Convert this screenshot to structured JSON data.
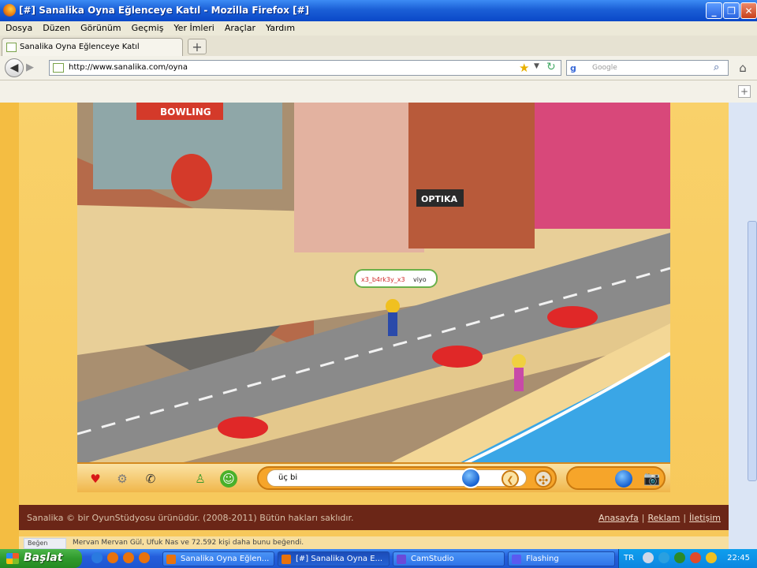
{
  "window": {
    "title": "[#] Sanalika Oyna Eğlenceye Katıl - Mozilla Firefox [#]",
    "minimize": "_",
    "maximize": "❐",
    "close": "✕"
  },
  "menu": {
    "items": [
      "Dosya",
      "Düzen",
      "Görünüm",
      "Geçmiş",
      "Yer İmleri",
      "Araçlar",
      "Yardım"
    ]
  },
  "tabs": [
    {
      "label": "Sanalika Oyna Eğlenceye Katıl"
    }
  ],
  "newtab": "+",
  "navbar": {
    "back": "◀",
    "forward": "▶",
    "url": "http://www.sanalika.com/oyna",
    "search_engine": "g",
    "search_placeholder": "Google",
    "home": "⌂"
  },
  "bookmarks": {
    "add": "+"
  },
  "game": {
    "player_name": "x3_b4rk3y_x3",
    "speech": "viyo",
    "shop_sign_1": "OPTIKA",
    "shop_sign_2": "BOWLING",
    "chat_input_value": "üç bi",
    "toolbar_icons": [
      "heart-icon",
      "gear-icon",
      "phone-icon",
      "person-icon",
      "smiley-icon",
      "speech-icon",
      "compass-icon",
      "camera-icon"
    ]
  },
  "footer": {
    "copyright": "Sanalika © bir OyunStüdyosu ürünüdür. (2008-2011) Bütün hakları saklıdır.",
    "links": [
      "Anasayfa",
      "Reklam",
      "İletişim"
    ]
  },
  "fb": {
    "like": "Beğen",
    "text": "Mervan Mervan Gül, Ufuk Nas ve 72.592 kişi daha bunu beğendi."
  },
  "taskbar": {
    "start": "Başlat",
    "tasks": [
      "Sanalika Oyna Eğlen...",
      "[#] Sanalika Oyna E...",
      "CamStudio",
      "Flashing"
    ],
    "lang": "TR",
    "clock": "22:45"
  },
  "colors": {
    "page_bg": "#f4bd42",
    "footer_bg": "#6b2617",
    "xp_blue": "#245edb",
    "start_green": "#2f9a2c"
  }
}
